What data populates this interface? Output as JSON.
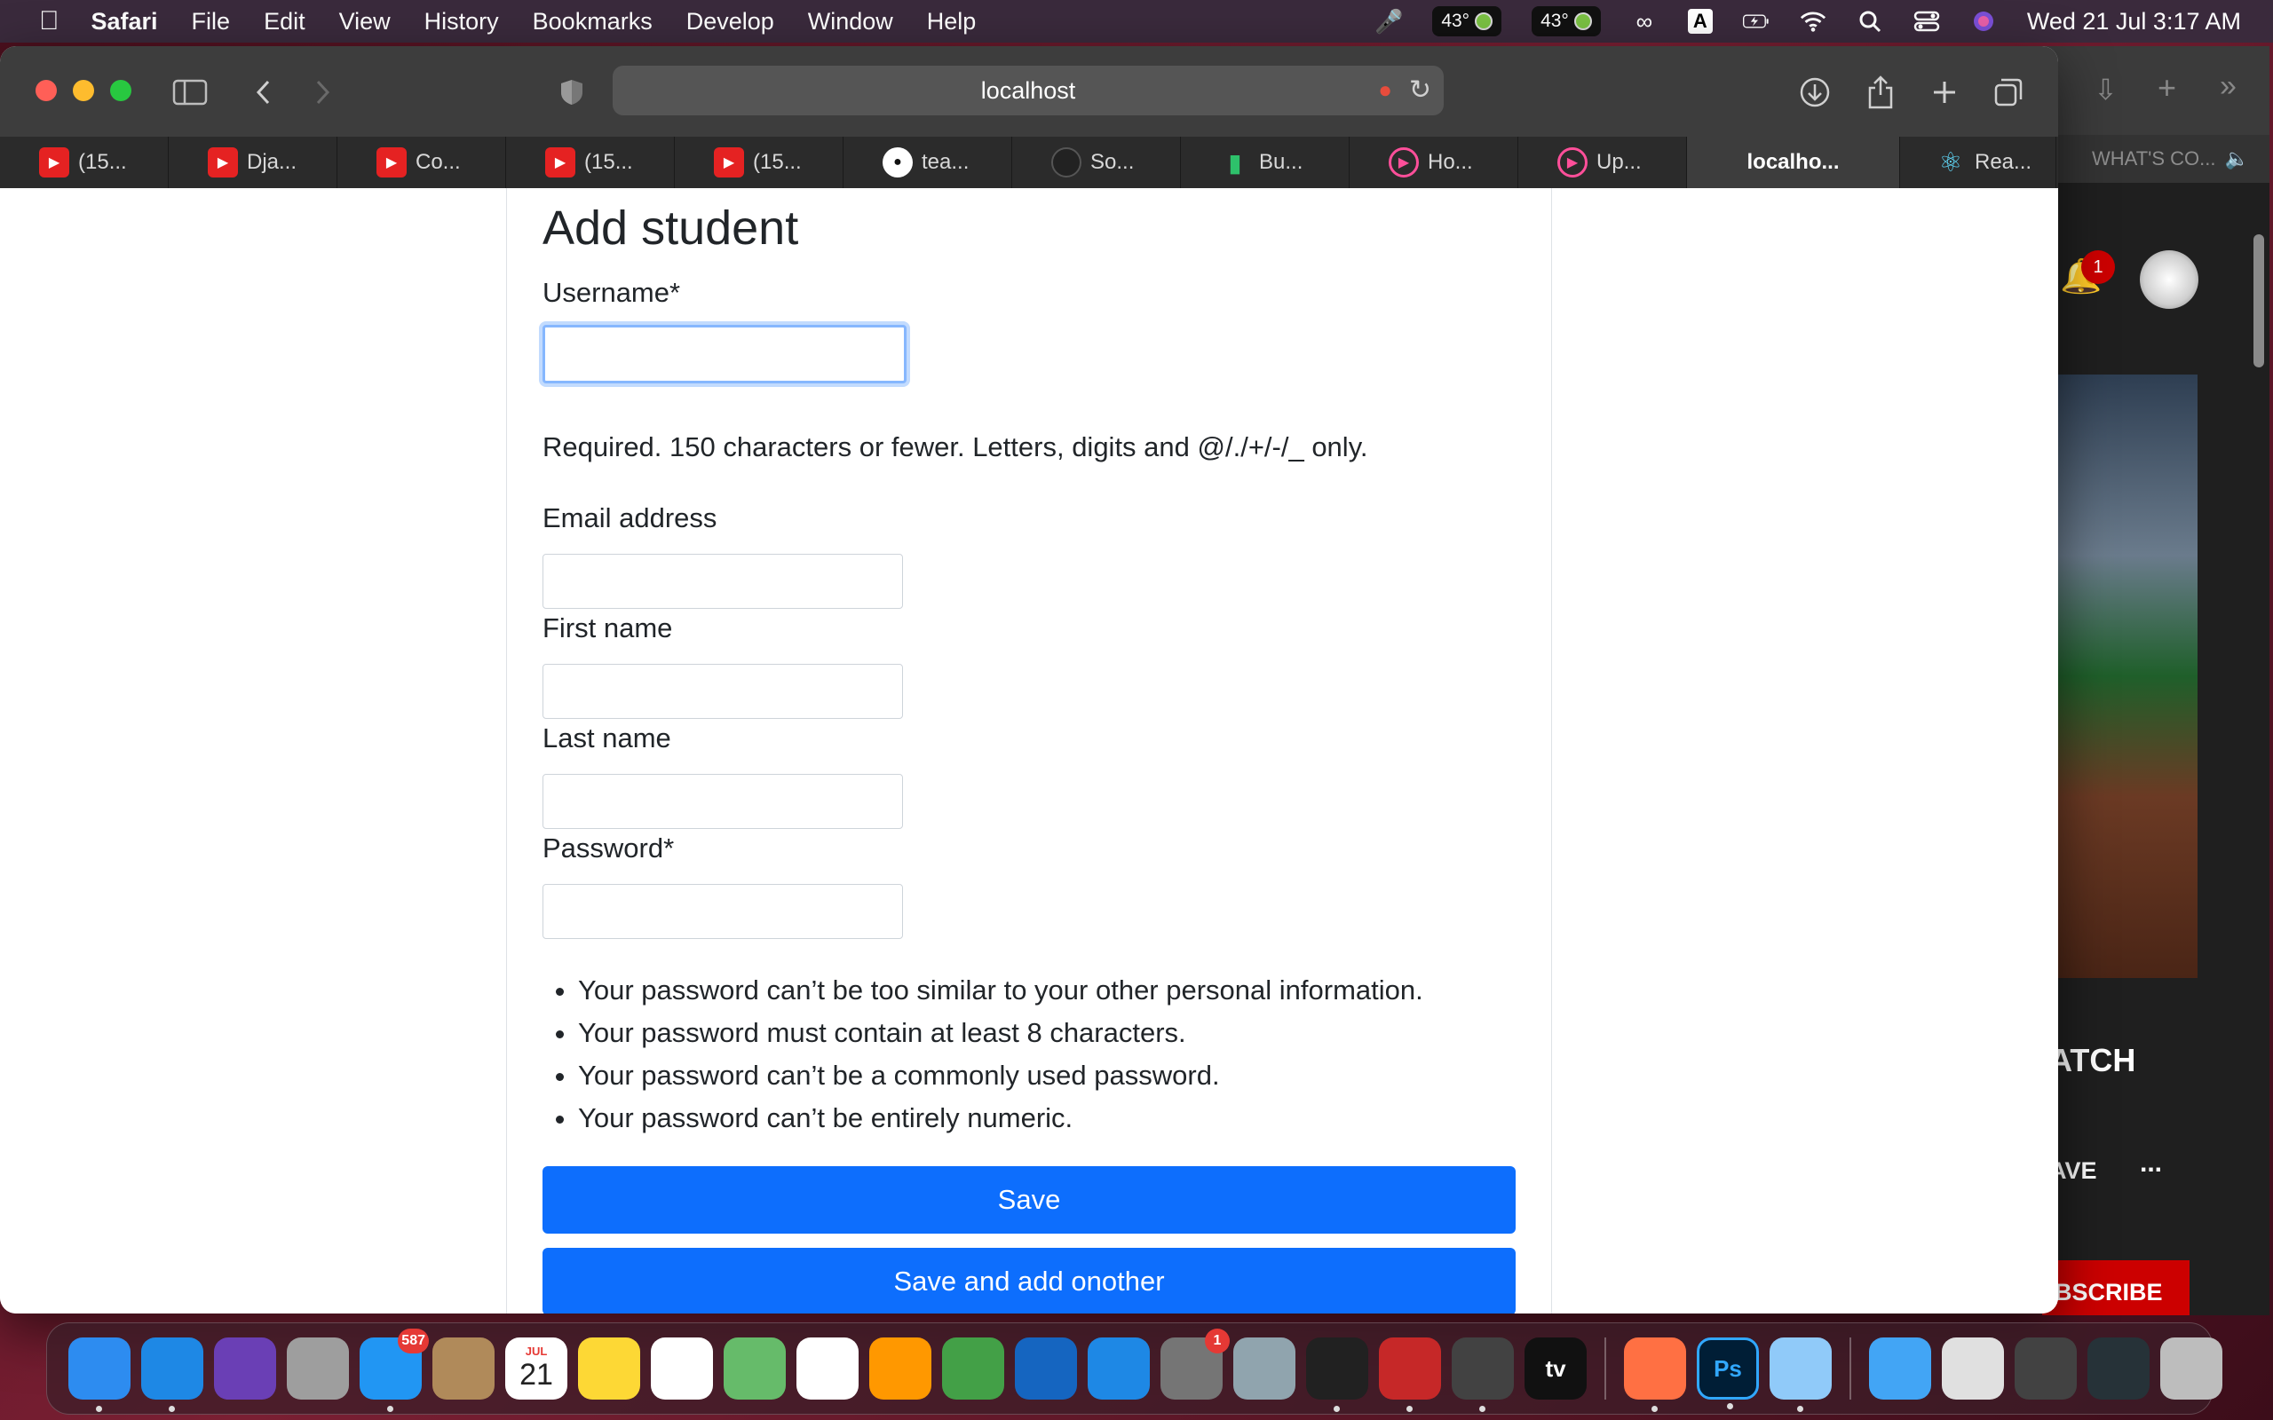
{
  "menubar": {
    "app": "Safari",
    "items": [
      "File",
      "Edit",
      "View",
      "History",
      "Bookmarks",
      "Develop",
      "Window",
      "Help"
    ],
    "temp1": "43°",
    "temp2": "43°",
    "input_source": "A",
    "clock": "Wed 21 Jul  3:17 AM"
  },
  "safari": {
    "address": "localhost",
    "tabs": [
      {
        "label": "(15...",
        "icon": "youtube-icon"
      },
      {
        "label": "Dja...",
        "icon": "youtube-icon"
      },
      {
        "label": "Co...",
        "icon": "youtube-icon"
      },
      {
        "label": "(15...",
        "icon": "youtube-icon"
      },
      {
        "label": "(15...",
        "icon": "youtube-icon"
      },
      {
        "label": "tea...",
        "icon": "github-icon"
      },
      {
        "label": "So...",
        "icon": "sonar-icon"
      },
      {
        "label": "Bu...",
        "icon": "bulb-icon"
      },
      {
        "label": "Ho...",
        "icon": "hotstar-icon"
      },
      {
        "label": "Up...",
        "icon": "hotstar-icon"
      },
      {
        "label": "localho...",
        "icon": ""
      },
      {
        "label": "Rea...",
        "icon": "react-icon"
      }
    ]
  },
  "background_window": {
    "tab_label": "WHAT'S CO...",
    "notification_count": "1",
    "watch_text": "ATCH",
    "save_text": "AVE",
    "more_text": "...",
    "subscribe_text": "BSCRIBE"
  },
  "form": {
    "title": "Add student",
    "username_label": "Username*",
    "username_value": "",
    "username_help": "Required. 150 characters or fewer. Letters, digits and @/./+/-/_ only.",
    "email_label": "Email address",
    "email_value": "",
    "first_name_label": "First name",
    "first_name_value": "",
    "last_name_label": "Last name",
    "last_name_value": "",
    "password_label": "Password*",
    "password_value": "",
    "password_rules": [
      "Your password can’t be too similar to your other personal information.",
      "Your password must contain at least 8 characters.",
      "Your password can’t be a commonly used password.",
      "Your password can’t be entirely numeric."
    ],
    "save_label": "Save",
    "save_add_label": "Save and add onother"
  },
  "dock": {
    "items": [
      {
        "name": "finder-icon",
        "color": "#2d8cf0"
      },
      {
        "name": "safari-icon",
        "color": "#1e88e5"
      },
      {
        "name": "siri-icon",
        "color": "#6a3fb5"
      },
      {
        "name": "launchpad-icon",
        "color": "#9e9e9e"
      },
      {
        "name": "mail-icon",
        "color": "#2196f3",
        "badge": "587"
      },
      {
        "name": "contacts-icon",
        "color": "#b08a5a"
      },
      {
        "name": "calendar-icon",
        "color": "#ffffff",
        "month": "JUL",
        "day": "21"
      },
      {
        "name": "notes-icon",
        "color": "#fdd835"
      },
      {
        "name": "reminders-icon",
        "color": "#ffffff"
      },
      {
        "name": "maps-icon",
        "color": "#66bb6a"
      },
      {
        "name": "photos-icon",
        "color": "#ffffff"
      },
      {
        "name": "pages-icon",
        "color": "#ff9800"
      },
      {
        "name": "numbers-icon",
        "color": "#43a047"
      },
      {
        "name": "keynote-icon",
        "color": "#1565c0"
      },
      {
        "name": "app-store-icon",
        "color": "#1e88e5"
      },
      {
        "name": "system-preferences-icon",
        "color": "#757575",
        "badge": "1"
      },
      {
        "name": "network-radar-icon",
        "color": "#90a4ae"
      },
      {
        "name": "terminal-icon",
        "color": "#212121"
      },
      {
        "name": "acrobat-icon",
        "color": "#c62828"
      },
      {
        "name": "sublime-text-icon",
        "color": "#424242"
      },
      {
        "name": "apple-tv-icon",
        "color": "#111111",
        "text": "tv"
      },
      {
        "name": "firefox-icon",
        "color": "#ff7043"
      },
      {
        "name": "photoshop-icon",
        "color": "#001e36",
        "text": "Ps"
      },
      {
        "name": "preview-icon",
        "color": "#90caf9"
      },
      {
        "name": "downloads-folder-icon",
        "color": "#42a5f5"
      },
      {
        "name": "recent-window-1-icon",
        "color": "#e0e0e0"
      },
      {
        "name": "recent-window-2-icon",
        "color": "#424242"
      },
      {
        "name": "recent-window-3-icon",
        "color": "#263238"
      },
      {
        "name": "trash-icon",
        "color": "#bdbdbd"
      }
    ]
  }
}
